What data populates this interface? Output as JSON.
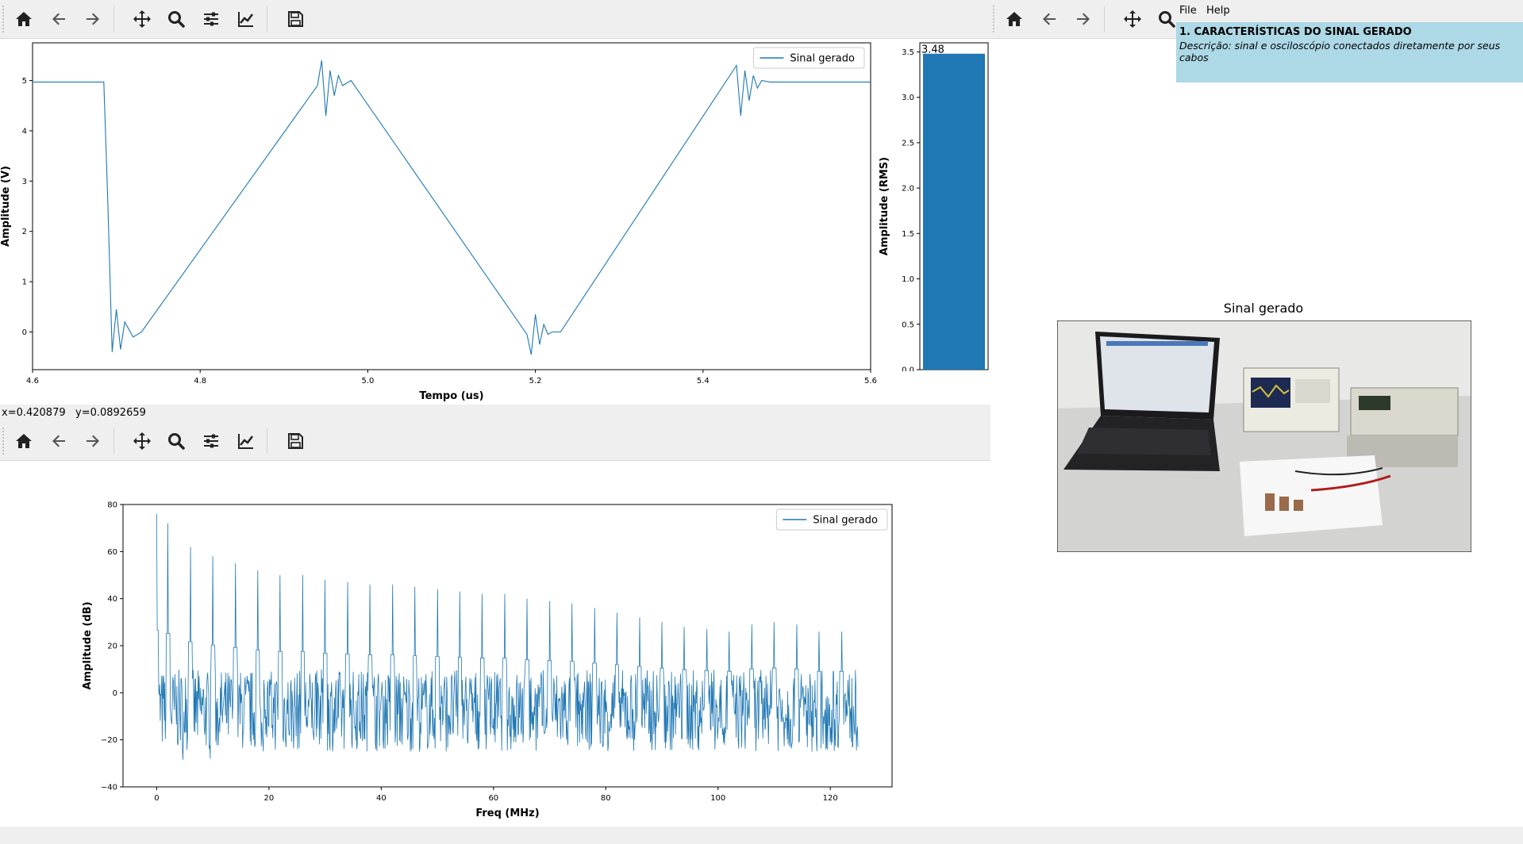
{
  "toolbar_icons": [
    "home-icon",
    "back-arrow-icon",
    "forward-arrow-icon",
    "pan-icon",
    "zoom-icon",
    "configure-subplots-icon",
    "edit-curve-icon",
    "save-icon"
  ],
  "status": {
    "x": "x=0.420879",
    "y": "y=0.0892659"
  },
  "menu": {
    "file": "File",
    "help": "Help"
  },
  "description": {
    "title": "1. CARACTERÍSTICAS DO SINAL GERADO",
    "text": "Descrição: sinal e osciloscópio conectados diretamente por seus cabos"
  },
  "photo": {
    "title": "Sinal gerado"
  },
  "colors": {
    "series": "#1f77b4",
    "desc_bg": "#add8e6",
    "toolbar_bg": "#efefef"
  },
  "chart_data": [
    {
      "type": "line",
      "title": "",
      "xlabel": "Tempo (us)",
      "ylabel": "Amplitude (V)",
      "xlim": [
        4.6,
        5.6
      ],
      "ylim": [
        -0.75,
        5.75
      ],
      "xticks": [
        "4.6",
        "4.8",
        "5.0",
        "5.2",
        "5.4",
        "5.6"
      ],
      "yticks": [
        "0",
        "1",
        "2",
        "3",
        "4",
        "5"
      ],
      "legend": "top-right",
      "series": [
        {
          "name": "Sinal gerado",
          "x": [
            4.6,
            4.685,
            4.69,
            4.695,
            4.7,
            4.705,
            4.71,
            4.72,
            4.73,
            4.94,
            4.945,
            4.95,
            4.955,
            4.96,
            4.965,
            4.97,
            4.98,
            5.19,
            5.195,
            5.2,
            5.205,
            5.21,
            5.215,
            5.22,
            5.23,
            5.44,
            5.445,
            5.45,
            5.455,
            5.46,
            5.465,
            5.47,
            5.48,
            5.6
          ],
          "y": [
            4.97,
            4.97,
            2.5,
            -0.4,
            0.45,
            -0.35,
            0.2,
            -0.1,
            0.0,
            4.9,
            5.4,
            4.3,
            5.2,
            4.7,
            5.1,
            4.9,
            5.0,
            -0.05,
            -0.45,
            0.35,
            -0.25,
            0.15,
            -0.05,
            0.0,
            0.0,
            5.3,
            4.3,
            5.2,
            4.6,
            5.1,
            4.85,
            5.0,
            4.97,
            4.97
          ]
        }
      ]
    },
    {
      "type": "bar",
      "title": "",
      "ylabel": "Amplitude (RMS)",
      "ylim": [
        0,
        3.6
      ],
      "yticks": [
        "0.0",
        "0.5",
        "1.0",
        "1.5",
        "2.0",
        "2.5",
        "3.0",
        "3.5"
      ],
      "categories": [
        ""
      ],
      "values": [
        3.48
      ],
      "data_label": "3.48"
    },
    {
      "type": "line",
      "title": "",
      "xlabel": "Freq (MHz)",
      "ylabel": "Amplitude (dB)",
      "xlim": [
        -6,
        131
      ],
      "ylim": [
        -40,
        80
      ],
      "xticks": [
        "0",
        "20",
        "40",
        "60",
        "80",
        "100",
        "120"
      ],
      "yticks": [
        "−40",
        "−20",
        "0",
        "20",
        "40",
        "60",
        "80"
      ],
      "legend": "top-right",
      "series": [
        {
          "name": "Sinal gerado",
          "noise_floor_db": [
            -25,
            10
          ],
          "harmonic_freqs_mhz": [
            0,
            2,
            6,
            10,
            14,
            18,
            22,
            26,
            30,
            34,
            38,
            42,
            46,
            50,
            54,
            58,
            62,
            66,
            70,
            74,
            78,
            82,
            86,
            90,
            94,
            98,
            102,
            106,
            110,
            114,
            118,
            122
          ],
          "harmonic_peaks_db": [
            76,
            72,
            62,
            58,
            55,
            52,
            50,
            50,
            48,
            47,
            46,
            46,
            45,
            44,
            43,
            42,
            42,
            40,
            39,
            38,
            36,
            34,
            32,
            30,
            28,
            27,
            26,
            29,
            30,
            29,
            26,
            26
          ]
        }
      ]
    }
  ]
}
